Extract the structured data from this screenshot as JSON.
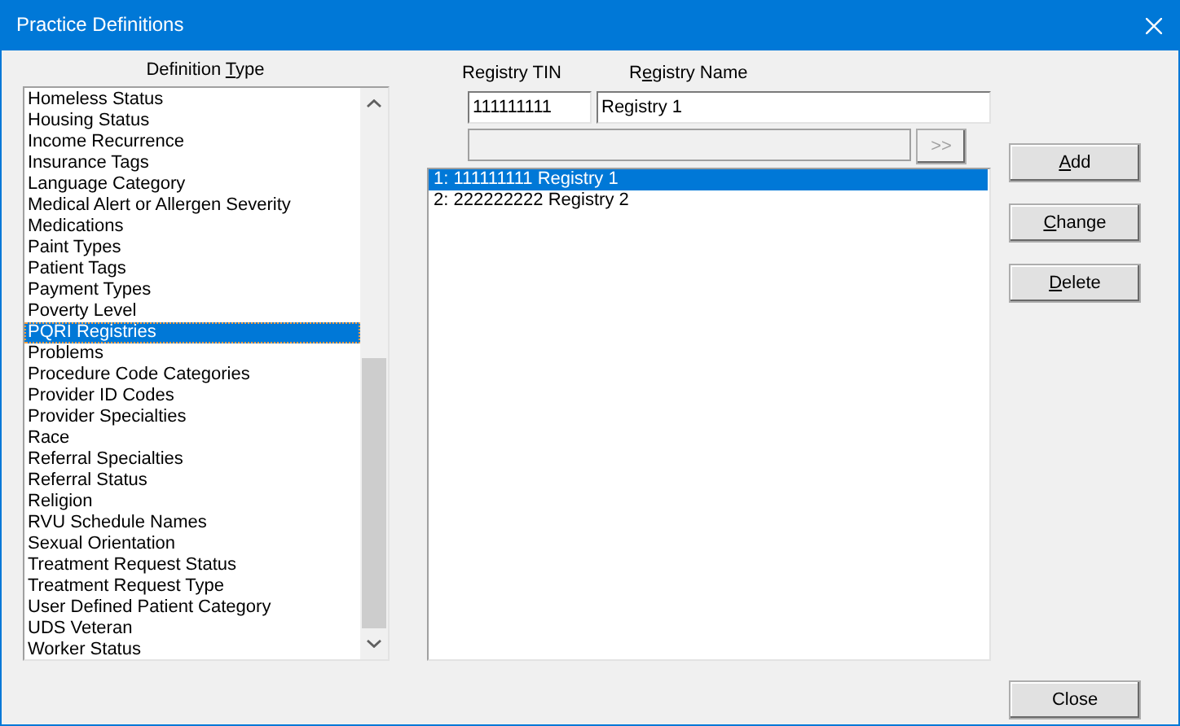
{
  "window": {
    "title": "Practice Definitions"
  },
  "definition_type": {
    "label_parts": {
      "before": "Definition ",
      "access_key": "T",
      "after": "ype"
    },
    "items": [
      {
        "label": "Homeless Status",
        "selected": false
      },
      {
        "label": "Housing Status",
        "selected": false
      },
      {
        "label": "Income Recurrence",
        "selected": false
      },
      {
        "label": "Insurance Tags",
        "selected": false
      },
      {
        "label": "Language Category",
        "selected": false
      },
      {
        "label": "Medical Alert or Allergen Severity",
        "selected": false
      },
      {
        "label": "Medications",
        "selected": false
      },
      {
        "label": "Paint Types",
        "selected": false
      },
      {
        "label": "Patient Tags",
        "selected": false
      },
      {
        "label": "Payment Types",
        "selected": false
      },
      {
        "label": "Poverty Level",
        "selected": false
      },
      {
        "label": "PQRI Registries",
        "selected": true
      },
      {
        "label": "Problems",
        "selected": false
      },
      {
        "label": "Procedure Code Categories",
        "selected": false
      },
      {
        "label": "Provider ID Codes",
        "selected": false
      },
      {
        "label": "Provider Specialties",
        "selected": false
      },
      {
        "label": "Race",
        "selected": false
      },
      {
        "label": "Referral Specialties",
        "selected": false
      },
      {
        "label": "Referral Status",
        "selected": false
      },
      {
        "label": "Religion",
        "selected": false
      },
      {
        "label": "RVU Schedule Names",
        "selected": false
      },
      {
        "label": "Sexual Orientation",
        "selected": false
      },
      {
        "label": "Treatment Request Status",
        "selected": false
      },
      {
        "label": "Treatment Request Type",
        "selected": false
      },
      {
        "label": "User Defined Patient Category",
        "selected": false
      },
      {
        "label": "UDS Veteran",
        "selected": false
      },
      {
        "label": "Worker Status",
        "selected": false
      }
    ]
  },
  "registry": {
    "tin_label_parts": {
      "before": "Registry TIN"
    },
    "name_label_parts": {
      "before": "R",
      "access_key": "e",
      "after": "gistry Name"
    },
    "tin_value": "111111111",
    "name_value": "Registry 1",
    "extra_field": {
      "disabled": true
    },
    "move_button": {
      "label": ">>",
      "disabled": true
    },
    "entries": [
      {
        "label": "1: 111111111 Registry 1",
        "selected": true
      },
      {
        "label": "2: 222222222 Registry 2",
        "selected": false
      }
    ]
  },
  "buttons": [
    {
      "label_parts": {
        "access_key": "A",
        "after": "dd"
      }
    },
    {
      "label_parts": {
        "access_key": "C",
        "after": "hange"
      }
    },
    {
      "label_parts": {
        "access_key": "D",
        "after": "elete"
      }
    }
  ],
  "close_button": {
    "label": "Close"
  }
}
